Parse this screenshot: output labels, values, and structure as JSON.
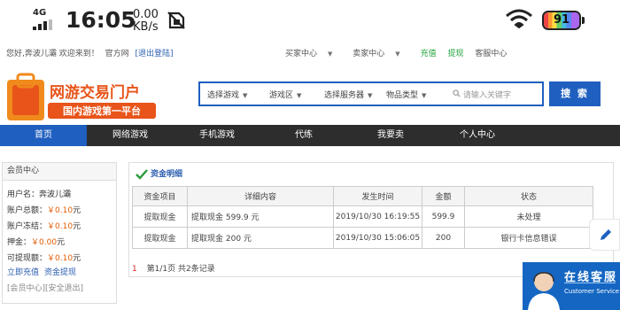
{
  "status_bar": {
    "network": "4G",
    "time": "16:05",
    "speed_value": "0.00",
    "speed_unit": "KB/s",
    "battery": "91"
  },
  "top_bar": {
    "greeting": "您好,奔波儿灞 欢迎来到！",
    "official": "官方网",
    "logout": "[退出登陆]",
    "buyer_center": "买家中心",
    "seller_center": "卖家中心",
    "recharge": "充值",
    "withdraw": "提现",
    "service_center": "客服中心"
  },
  "logo": {
    "main": "网游交易门户",
    "sub": "国内游戏第一平台"
  },
  "search": {
    "select_game": "选择游戏",
    "game_zone": "游戏区",
    "select_server": "选择服务器",
    "item_type": "物品类型",
    "placeholder": "请输入关键字",
    "button": "搜 索"
  },
  "nav": [
    "首页",
    "网络游戏",
    "手机游戏",
    "代练",
    "我要卖",
    "个人中心"
  ],
  "member": {
    "title": "会员中心",
    "username_label": "用户名：",
    "username": "奔波儿灞",
    "total_label": "账户总额：",
    "total": "￥0.10",
    "frozen_label": "账户冻结：",
    "frozen": "￥0.10",
    "deposit_label": "押金：",
    "deposit": "￥0.00",
    "withdrawable_label": "可提现额：",
    "withdrawable": "￥0.10",
    "yuan": "元",
    "link_recharge": "立即充值",
    "link_withdraw": "资金提现",
    "sys_member": "[会员中心]",
    "sys_logout": "[安全退出]"
  },
  "funds": {
    "title": "资金明细",
    "headers": [
      "资金项目",
      "详细内容",
      "发生时间",
      "金额",
      "状态"
    ],
    "rows": [
      [
        "提取现金",
        "提取现金 599.9 元",
        "2019/10/30 16:19:55",
        "599.9",
        "未处理"
      ],
      [
        "提取现金",
        "提取现金 200 元",
        "2019/10/30 15:06:05",
        "200",
        "银行卡信息错误"
      ]
    ],
    "page_num": "1",
    "page_info_prefix": "第1/1页",
    "page_info_total": "共2条记录"
  },
  "service": {
    "title": "在线客服",
    "subtitle": "Customer Service"
  }
}
